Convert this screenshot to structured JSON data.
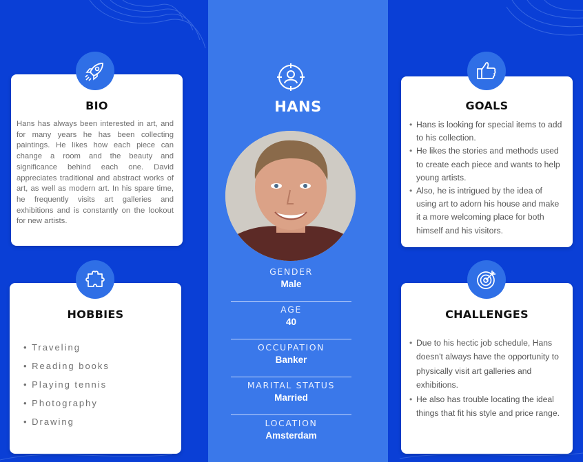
{
  "colors": {
    "background": "#0a3fd6",
    "center_column": "#3a78ea",
    "badge": "#2f6fe6",
    "card": "#ffffff"
  },
  "persona": {
    "name": "HANS",
    "icon": "user-target-icon",
    "photo": "portrait-photo"
  },
  "bio": {
    "title": "BIO",
    "icon": "rocket-icon",
    "text": "Hans has always been interested in art, and for many years he has been collecting paintings. He likes how each piece can change a room and the beauty and significance behind each one. David appreciates traditional and abstract works of art, as well as modern art. In his spare time, he frequently visits art galleries and exhibitions and is constantly on the lookout for new artists."
  },
  "hobbies": {
    "title": "HOBBIES",
    "icon": "puzzle-icon",
    "items": [
      "Traveling",
      "Reading books",
      "Playing tennis",
      "Photography",
      "Drawing"
    ]
  },
  "goals": {
    "title": "GOALS",
    "icon": "thumbs-up-icon",
    "items": [
      "Hans is looking for special items to add to his collection.",
      "He likes the stories and methods used to create each piece and wants to help young artists.",
      "Also, he is intrigued by the idea of using art to adorn his house and make it a more welcoming place for both himself and his visitors."
    ]
  },
  "challenges": {
    "title": "CHALLENGES",
    "icon": "target-icon",
    "items": [
      "Due to his hectic job schedule, Hans doesn't always have the opportunity to physically visit art galleries and exhibitions.",
      "He also has trouble locating the ideal things that fit his style and price range."
    ]
  },
  "facts": [
    {
      "label": "GENDER",
      "value": "Male"
    },
    {
      "label": "AGE",
      "value": "40"
    },
    {
      "label": "OCCUPATION",
      "value": "Banker"
    },
    {
      "label": "MARITAL STATUS",
      "value": "Married"
    },
    {
      "label": "LOCATION",
      "value": "Amsterdam"
    }
  ]
}
